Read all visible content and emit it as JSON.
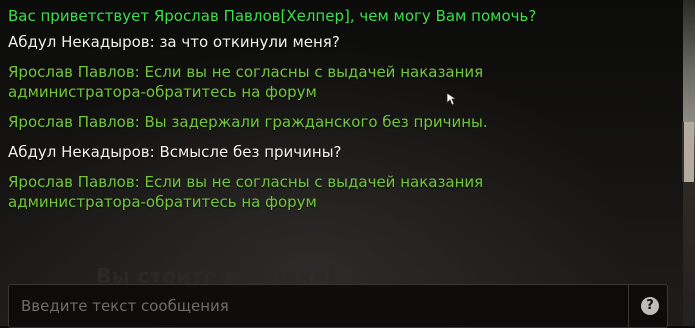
{
  "chat": {
    "messages": [
      {
        "type": "helper",
        "text": "Вас приветствует Ярослав Павлов[Хелпер], чем могу Вам помочь?"
      },
      {
        "type": "player",
        "text": "Абдул Некадыров: за что откинули меня?"
      },
      {
        "type": "admin",
        "text": "Ярослав Павлов: Если вы не согласны с выдачей наказания администратора-обратитесь на форум"
      },
      {
        "type": "admin",
        "text": "Ярослав Павлов: Вы задержали гражданского без причины."
      },
      {
        "type": "player",
        "text": "Абдул Некадыров: Всмысле без причины?"
      },
      {
        "type": "admin",
        "text": "Ярослав Павлов: Если вы не согласны с выдачей наказания администратора-обратитесь на форум"
      }
    ]
  },
  "background": {
    "faded_text": "Вы стоите в стойке!"
  },
  "input": {
    "placeholder": "Введите текст сообщения",
    "value": ""
  },
  "help_button": {
    "label": "?"
  },
  "colors": {
    "helper": "#3ee04c",
    "player": "#f2f2f2",
    "admin": "#74c93a"
  }
}
